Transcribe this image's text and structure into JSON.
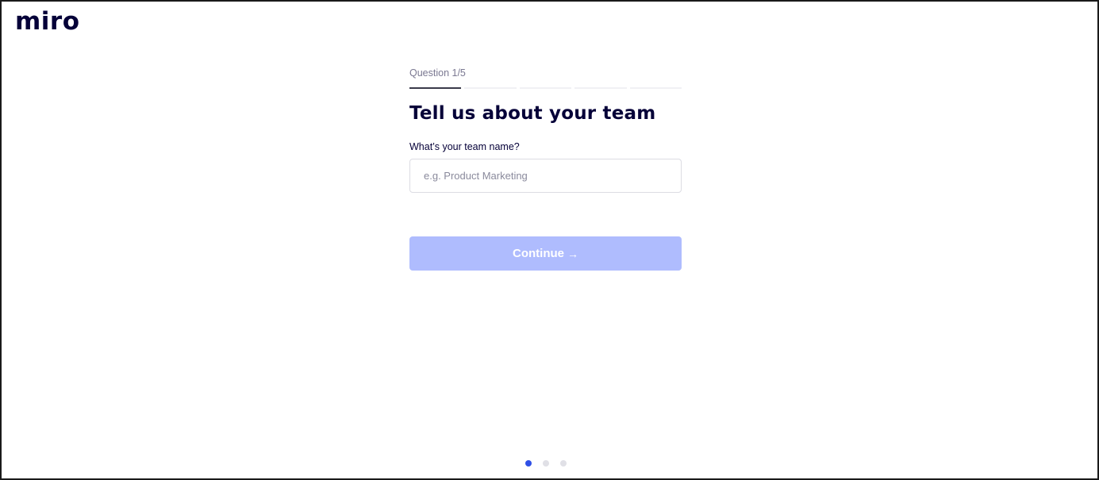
{
  "brand": {
    "logo_text": "miro"
  },
  "onboarding": {
    "question_counter": "Question 1/5",
    "progress": {
      "current": 1,
      "total": 5
    },
    "heading": "Tell us about your team",
    "team_name_label": "What’s your team name?",
    "team_name_placeholder": "e.g. Product Marketing",
    "team_name_value": "",
    "continue_label": "Continue",
    "continue_icon": "arrow-right-icon",
    "continue_enabled": false
  },
  "pagination": {
    "current": 1,
    "total": 3
  },
  "colors": {
    "text_primary": "#050038",
    "button_disabled": "#afbcfe",
    "dot_active": "#2f50e6",
    "dot_inactive": "#e0e0e6"
  }
}
